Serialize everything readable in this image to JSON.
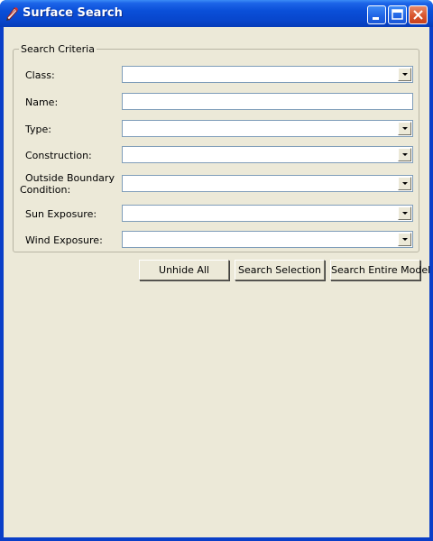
{
  "window": {
    "title": "Surface Search",
    "app_icon": "pencil-icon",
    "controls": {
      "minimize_icon": "minimize-icon",
      "maximize_icon": "maximize-icon",
      "close_icon": "close-icon"
    },
    "colors": {
      "titlebar": "#0a4fd8",
      "client_background": "#ece9d8",
      "close_button": "#d8552e"
    }
  },
  "search_criteria": {
    "legend": "Search Criteria",
    "fields": {
      "class": {
        "label": "Class:",
        "value": ""
      },
      "name": {
        "label": "Name:",
        "value": ""
      },
      "type": {
        "label": "Type:",
        "value": ""
      },
      "construction": {
        "label": "Construction:",
        "value": ""
      },
      "outside_boundary_condition": {
        "label_line1": "Outside Boundary",
        "label_line2": "Condition:",
        "value": ""
      },
      "sun_exposure": {
        "label": "Sun Exposure:",
        "value": ""
      },
      "wind_exposure": {
        "label": "Wind Exposure:",
        "value": ""
      }
    }
  },
  "actions": {
    "unhide_all": "Unhide All",
    "search_selection": "Search Selection",
    "search_entire_model": "Search Entire Model"
  }
}
